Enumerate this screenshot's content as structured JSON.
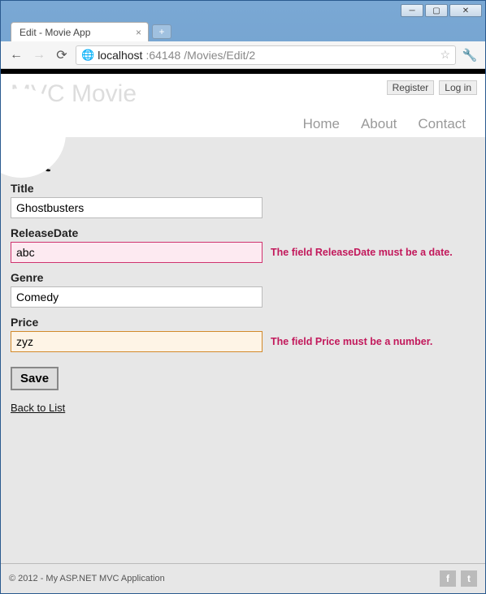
{
  "window": {
    "tab_title": "Edit - Movie App"
  },
  "browser": {
    "url_host": "localhost",
    "url_port": ":64148",
    "url_path": "/Movies/Edit/2"
  },
  "header": {
    "brand": "MVC Movie",
    "auth": {
      "register": "Register",
      "login": "Log in"
    },
    "nav": {
      "home": "Home",
      "about": "About",
      "contact": "Contact"
    }
  },
  "form": {
    "heading": "Edit",
    "title": {
      "label": "Title",
      "value": "Ghostbusters"
    },
    "releaseDate": {
      "label": "ReleaseDate",
      "value": "abc",
      "error": "The field ReleaseDate must be a date."
    },
    "genre": {
      "label": "Genre",
      "value": "Comedy"
    },
    "price": {
      "label": "Price",
      "value": "zyz",
      "error": "The field Price must be a number."
    },
    "save": "Save",
    "back": "Back to List"
  },
  "footer": {
    "text": "© 2012 - My ASP.NET MVC Application"
  }
}
